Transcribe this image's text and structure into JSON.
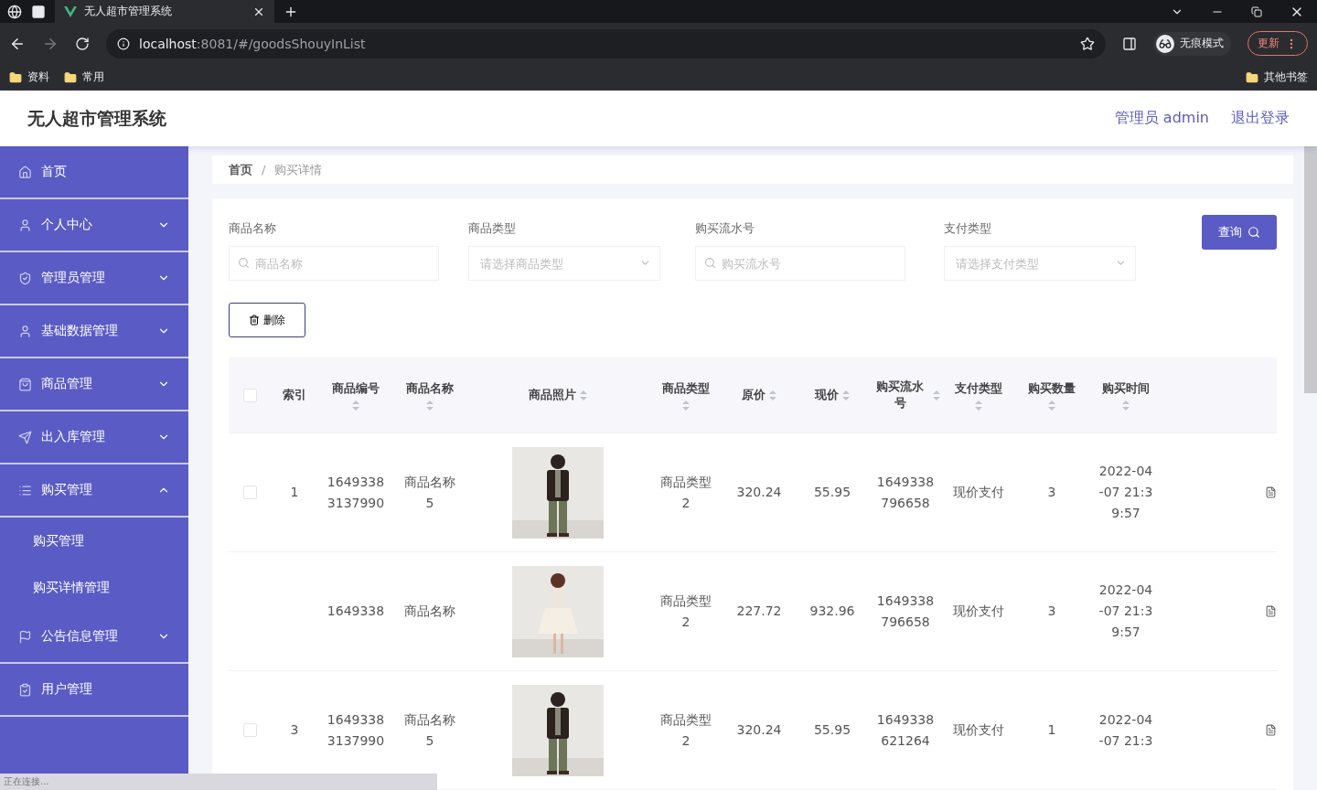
{
  "browser": {
    "tab_title": "无人超市管理系统",
    "url_host": "localhost",
    "url_rest": ":8081/#/goodsShouyInList",
    "profile": "无痕模式",
    "update": "更新",
    "bookmarks": [
      "资料",
      "常用"
    ],
    "other_bookmarks": "其他书签"
  },
  "header": {
    "title": "无人超市管理系统",
    "user": "管理员 admin",
    "logout": "退出登录"
  },
  "sidebar": {
    "items": [
      {
        "label": "首页",
        "expandable": false
      },
      {
        "label": "个人中心",
        "expandable": true,
        "expanded": false
      },
      {
        "label": "管理员管理",
        "expandable": true,
        "expanded": false
      },
      {
        "label": "基础数据管理",
        "expandable": true,
        "expanded": false
      },
      {
        "label": "商品管理",
        "expandable": true,
        "expanded": false
      },
      {
        "label": "出入库管理",
        "expandable": true,
        "expanded": false
      },
      {
        "label": "购买管理",
        "expandable": true,
        "expanded": true,
        "children": [
          {
            "label": "购买管理"
          },
          {
            "label": "购买详情管理"
          }
        ]
      },
      {
        "label": "公告信息管理",
        "expandable": true,
        "expanded": false
      },
      {
        "label": "用户管理",
        "expandable": false
      }
    ]
  },
  "breadcrumb": {
    "items": [
      "首页",
      "购买详情"
    ],
    "separator": "/"
  },
  "filters": [
    {
      "label": "商品名称",
      "kind": "search",
      "placeholder": "商品名称"
    },
    {
      "label": "商品类型",
      "kind": "select",
      "placeholder": "请选择商品类型"
    },
    {
      "label": "购买流水号",
      "kind": "search",
      "placeholder": "购买流水号"
    },
    {
      "label": "支付类型",
      "kind": "select",
      "placeholder": "请选择支付类型"
    }
  ],
  "query_button": "查询",
  "delete_button": "删除",
  "table": {
    "select_all_checked": false,
    "columns": [
      {
        "label": "索引",
        "sortable": false
      },
      {
        "label": "商品编号",
        "sortable": true
      },
      {
        "label": "商品名称",
        "sortable": true
      },
      {
        "label": "商品照片",
        "sortable": true
      },
      {
        "label": "商品类型",
        "sortable": true
      },
      {
        "label": "原价",
        "sortable": true
      },
      {
        "label": "现价",
        "sortable": true
      },
      {
        "label": "购买流水号",
        "sortable": true
      },
      {
        "label": "支付类型",
        "sortable": true
      },
      {
        "label": "购买数量",
        "sortable": true
      },
      {
        "label": "购买时间",
        "sortable": true
      }
    ],
    "rows": [
      {
        "index": "1",
        "checked": false,
        "code": "1649338\n3137990",
        "name": "商品名称\n5",
        "type": "商品类型\n2",
        "price": "320.24",
        "current": "55.95",
        "serial": "1649338\n796658",
        "pay": "现价支付",
        "qty": "3",
        "time": "2022-04\n-07 21:3\n9:57"
      },
      {
        "code": "1649338",
        "name": "商品名称",
        "type": "商品类型\n2",
        "price": "227.72",
        "current": "932.96",
        "serial": "1649338\n796658",
        "pay": "现价支付",
        "qty": "3",
        "time": "2022-04\n-07 21:3\n9:57"
      },
      {
        "index": "3",
        "checked": false,
        "code": "1649338\n3137990",
        "name": "商品名称\n5",
        "type": "商品类型\n2",
        "price": "320.24",
        "current": "55.95",
        "serial": "1649338\n621264",
        "pay": "现价支付",
        "qty": "1",
        "time": "2022-04\n-07 21:3"
      }
    ]
  },
  "status_bar": "正在连接..."
}
